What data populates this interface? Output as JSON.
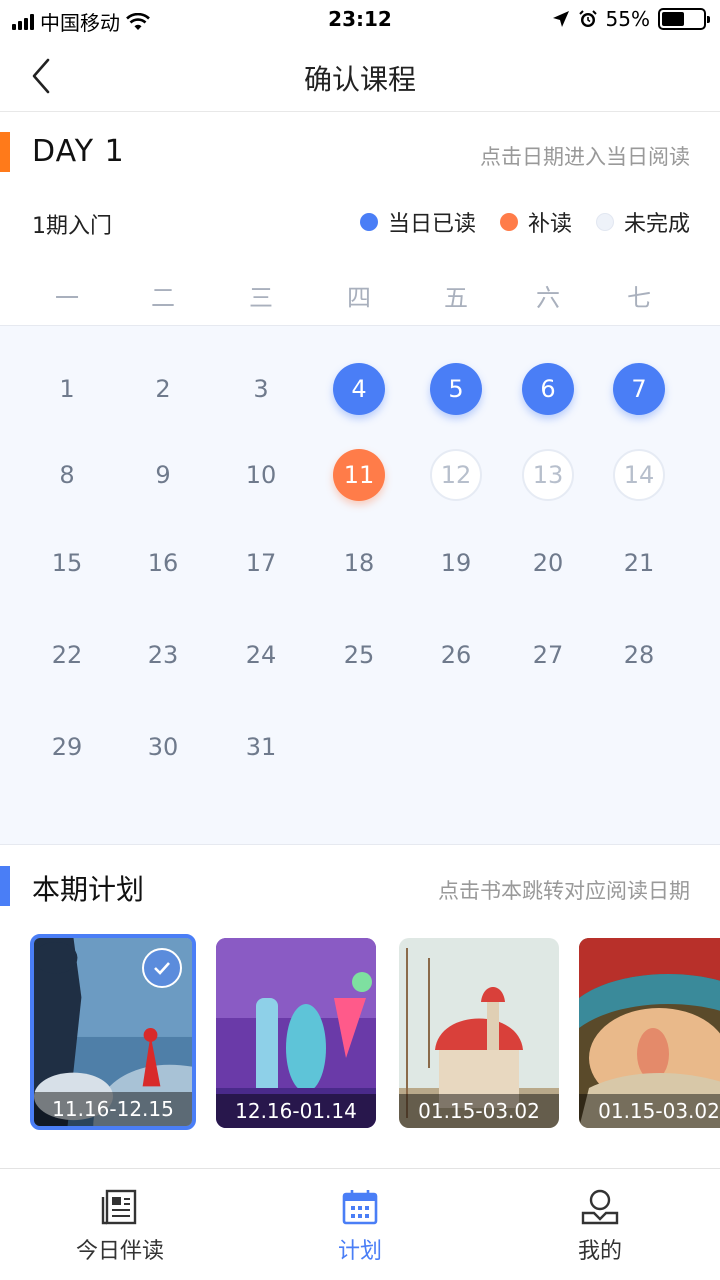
{
  "status_bar": {
    "carrier": "中国移动",
    "time": "23:12",
    "battery": "55%",
    "battery_level": 0.55
  },
  "nav": {
    "title": "确认课程",
    "back_icon": "chevron-left-icon"
  },
  "day": {
    "label": "DAY 1",
    "hint": "点击日期进入当日阅读",
    "accent": "#ff7a1a"
  },
  "period": "1期入门",
  "legend": [
    {
      "label": "当日已读",
      "color": "#4a7ef6"
    },
    {
      "label": "补读",
      "color": "#ff7c49"
    },
    {
      "label": "未完成",
      "color": "#eef2f9"
    }
  ],
  "weekdays": [
    "一",
    "二",
    "三",
    "四",
    "五",
    "六",
    "七"
  ],
  "calendar": [
    [
      {
        "d": "1",
        "s": ""
      },
      {
        "d": "2",
        "s": ""
      },
      {
        "d": "3",
        "s": ""
      },
      {
        "d": "4",
        "s": "read"
      },
      {
        "d": "5",
        "s": "read"
      },
      {
        "d": "6",
        "s": "read"
      },
      {
        "d": "7",
        "s": "read"
      }
    ],
    [
      {
        "d": "8",
        "s": ""
      },
      {
        "d": "9",
        "s": ""
      },
      {
        "d": "10",
        "s": ""
      },
      {
        "d": "11",
        "s": "makeup"
      },
      {
        "d": "12",
        "s": "pending"
      },
      {
        "d": "13",
        "s": "pending"
      },
      {
        "d": "14",
        "s": "pending"
      }
    ],
    [
      {
        "d": "15",
        "s": ""
      },
      {
        "d": "16",
        "s": ""
      },
      {
        "d": "17",
        "s": ""
      },
      {
        "d": "18",
        "s": ""
      },
      {
        "d": "19",
        "s": ""
      },
      {
        "d": "20",
        "s": ""
      },
      {
        "d": "21",
        "s": ""
      }
    ],
    [
      {
        "d": "22",
        "s": ""
      },
      {
        "d": "23",
        "s": ""
      },
      {
        "d": "24",
        "s": ""
      },
      {
        "d": "25",
        "s": ""
      },
      {
        "d": "26",
        "s": ""
      },
      {
        "d": "27",
        "s": ""
      },
      {
        "d": "28",
        "s": ""
      }
    ],
    [
      {
        "d": "29",
        "s": ""
      },
      {
        "d": "30",
        "s": ""
      },
      {
        "d": "31",
        "s": ""
      }
    ]
  ],
  "plan": {
    "label": "本期计划",
    "hint": "点击书本跳转对应阅读日期",
    "accent": "#4a7ef6",
    "books": [
      {
        "date": "11.16-12.15",
        "selected": true
      },
      {
        "date": "12.16-01.14",
        "selected": false
      },
      {
        "date": "01.15-03.02",
        "selected": false
      },
      {
        "date": "01.15-03.02",
        "selected": false
      }
    ]
  },
  "tabs": [
    {
      "label": "今日伴读",
      "icon": "newspaper-icon",
      "active": false
    },
    {
      "label": "计划",
      "icon": "calendar-icon",
      "active": true
    },
    {
      "label": "我的",
      "icon": "profile-icon",
      "active": false
    }
  ]
}
